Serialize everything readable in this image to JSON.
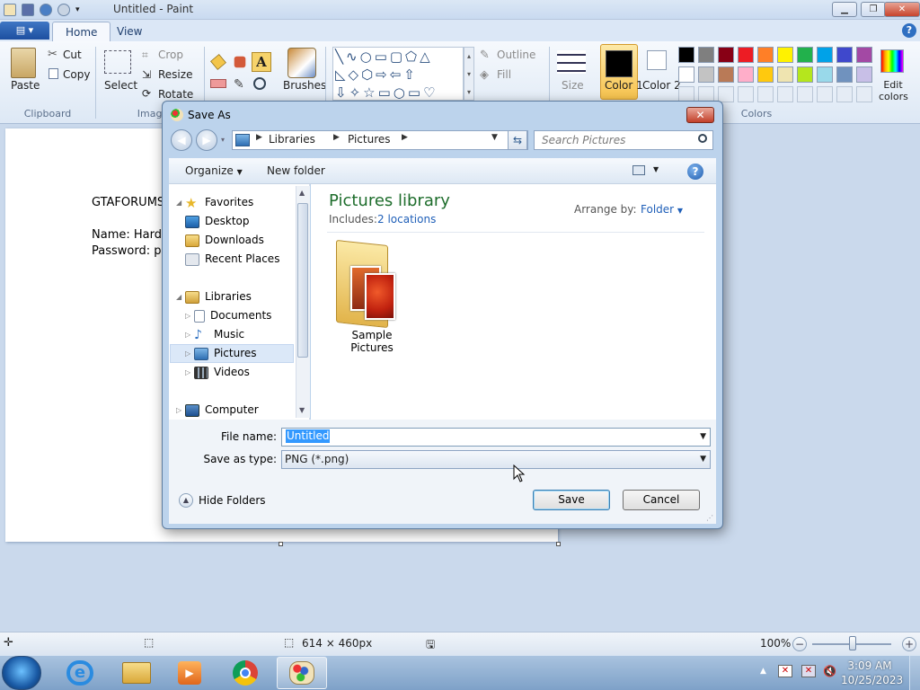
{
  "app": {
    "title": "Untitled - Paint",
    "file_menu": "▤ ▾",
    "tabs": [
      "Home",
      "View"
    ],
    "help": "?"
  },
  "ribbon": {
    "clipboard": {
      "paste": "Paste",
      "cut": "Cut",
      "copy": "Copy",
      "label": "Clipboard"
    },
    "image": {
      "select": "Select",
      "crop": "Crop",
      "resize": "Resize",
      "rotate": "Rotate",
      "label": "Image"
    },
    "brushes": "Brushes",
    "shapes": {
      "outline": "Outline",
      "fill": "Fill"
    },
    "size": "Size",
    "color1": "Color 1",
    "color2": "Color 2",
    "edit_colors": "Edit colors",
    "colors_label": "Colors",
    "palette_row1": [
      "#000000",
      "#7f7f7f",
      "#880015",
      "#ed1c24",
      "#ff7f27",
      "#fff200",
      "#22b14c",
      "#00a2e8",
      "#3f48cc",
      "#a349a4"
    ],
    "palette_row2": [
      "#ffffff",
      "#c3c3c3",
      "#b97a57",
      "#ffaec9",
      "#ffc90e",
      "#efe4b0",
      "#b5e61d",
      "#99d9ea",
      "#7092be",
      "#c8bfe7"
    ],
    "color1_value": "#000000",
    "color2_value": "#ffffff"
  },
  "canvas": {
    "line1": "GTAFORUMS",
    "line2": "Name: Hardc",
    "line3": "Password: pa"
  },
  "statusbar": {
    "dimensions": "614 × 460px",
    "zoom": "100%"
  },
  "taskbar": {
    "time": "3:09 AM",
    "date": "10/25/2023"
  },
  "dialog": {
    "title": "Save As",
    "close": "✕",
    "breadcrumb": [
      "Libraries",
      "Pictures"
    ],
    "search_placeholder": "Search Pictures",
    "toolbar": {
      "organize": "Organize",
      "new_folder": "New folder",
      "help": "?"
    },
    "nav": {
      "favorites": "Favorites",
      "desktop": "Desktop",
      "downloads": "Downloads",
      "recent": "Recent Places",
      "libraries": "Libraries",
      "documents": "Documents",
      "music": "Music",
      "pictures": "Pictures",
      "videos": "Videos",
      "computer": "Computer"
    },
    "library_title": "Pictures library",
    "includes_label": "Includes:",
    "includes_link": "2 locations",
    "arrange_label": "Arrange by:",
    "arrange_value": "Folder",
    "folder_name": "Sample Pictures",
    "file_name_label": "File name:",
    "file_name_value": "Untitled",
    "save_type_label": "Save as type:",
    "save_type_value": "PNG (*.png)",
    "hide_folders": "Hide Folders",
    "save_button": "Save",
    "cancel_button": "Cancel"
  }
}
